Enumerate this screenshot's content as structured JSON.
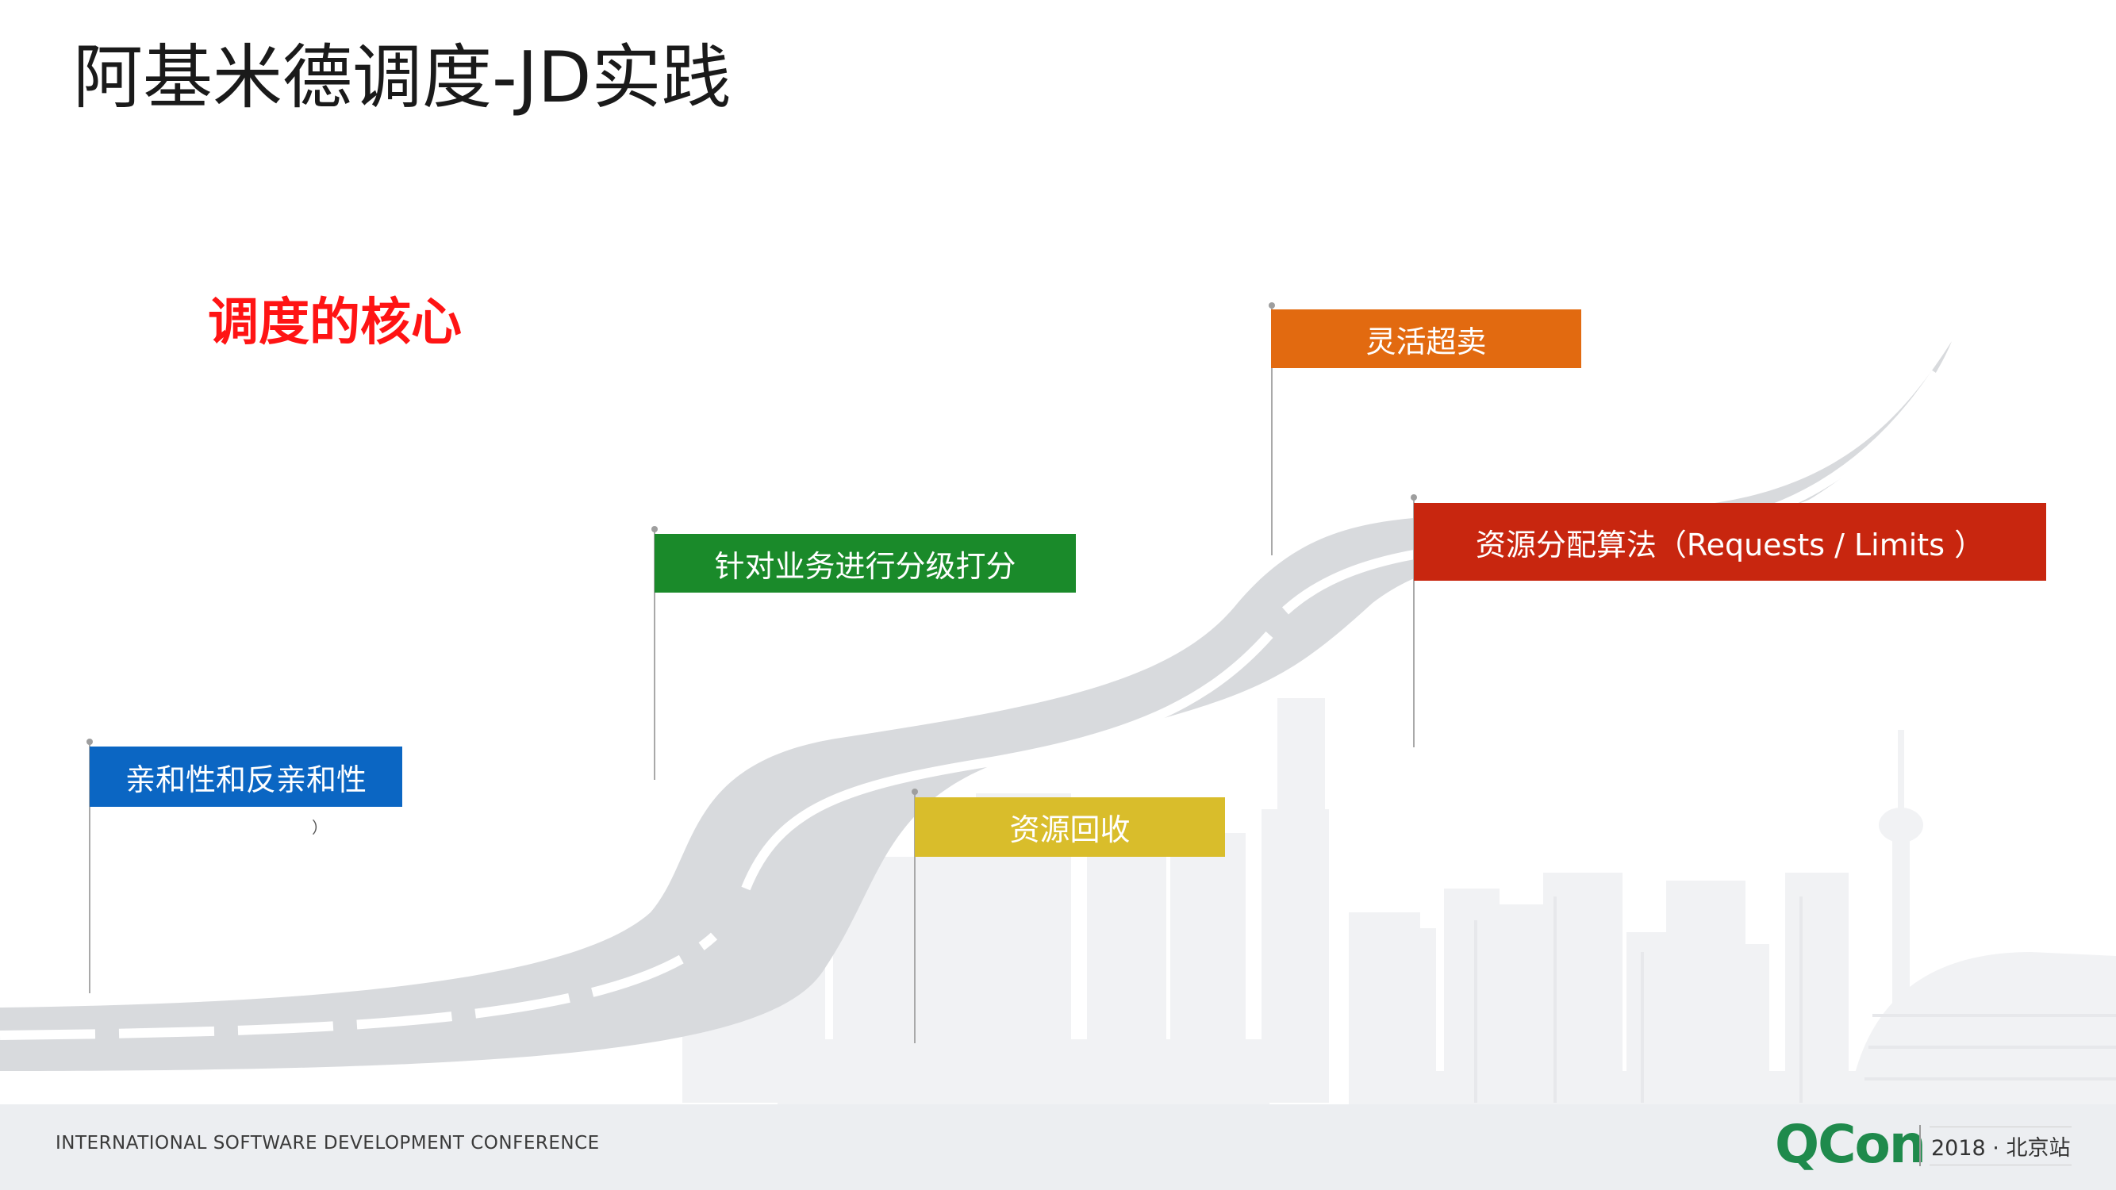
{
  "slide": {
    "title": "阿基米德调度-JD实践",
    "subtitle": "调度的核心"
  },
  "flags": {
    "affinity": {
      "label": "亲和性和反亲和性",
      "color": "#0b66c3"
    },
    "grading": {
      "label": "针对业务进行分级打分",
      "color": "#1a8a2a"
    },
    "reclaim": {
      "label": "资源回收",
      "color": "#d9bd2b"
    },
    "oversell": {
      "label": "灵活超卖",
      "color": "#e26a10"
    },
    "allocation": {
      "label": "资源分配算法（Requests / Limits ）",
      "color": "#c8260f"
    }
  },
  "stray_glyph": "）",
  "footer": {
    "conference": "INTERNATIONAL SOFTWARE DEVELOPMENT CONFERENCE",
    "logo": "QCon",
    "edition": "2018 · 北京站"
  },
  "colors": {
    "road": "#d8dadd",
    "road_stripe": "#ffffff",
    "skyline": "#f0f1f3",
    "footer_band": "#eceef1",
    "pole": "#9e9e9e"
  }
}
